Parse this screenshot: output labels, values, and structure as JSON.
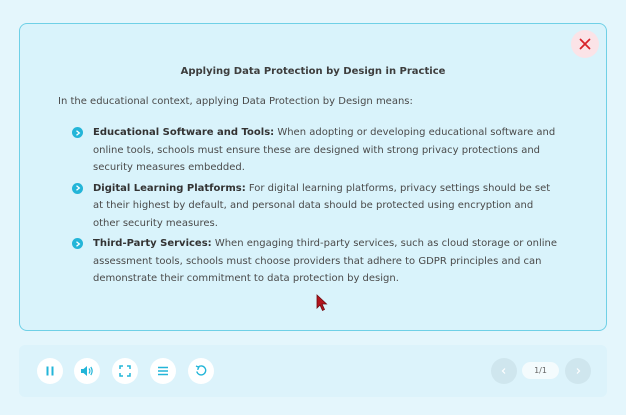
{
  "content": {
    "title": "Applying Data Protection by Design in Practice",
    "intro": "In the educational context, applying Data Protection by Design means:",
    "items": [
      {
        "heading": "Educational Software and Tools:",
        "text": " When adopting or developing educational software and online tools, schools must ensure these are designed with strong privacy protections and security measures embedded."
      },
      {
        "heading": "Digital Learning Platforms:",
        "text": " For digital learning platforms, privacy settings should be set at their highest by default, and personal data should be protected using encryption and other security measures."
      },
      {
        "heading": "Third-Party Services:",
        "text": " When engaging third-party services, such as cloud storage or online assessment tools, schools must choose providers that adhere to GDPR principles and can demonstrate their commitment to data protection by design."
      }
    ]
  },
  "controls": {
    "page_indicator": "1/1",
    "icons": [
      "pause-icon",
      "volume-icon",
      "fullscreen-icon",
      "menu-icon",
      "replay-icon",
      "chevron-left-icon",
      "chevron-right-icon",
      "close-icon"
    ]
  },
  "colors": {
    "accent": "#23b5d8",
    "panel_border": "#6fd0e6",
    "close": "#d8232a"
  }
}
